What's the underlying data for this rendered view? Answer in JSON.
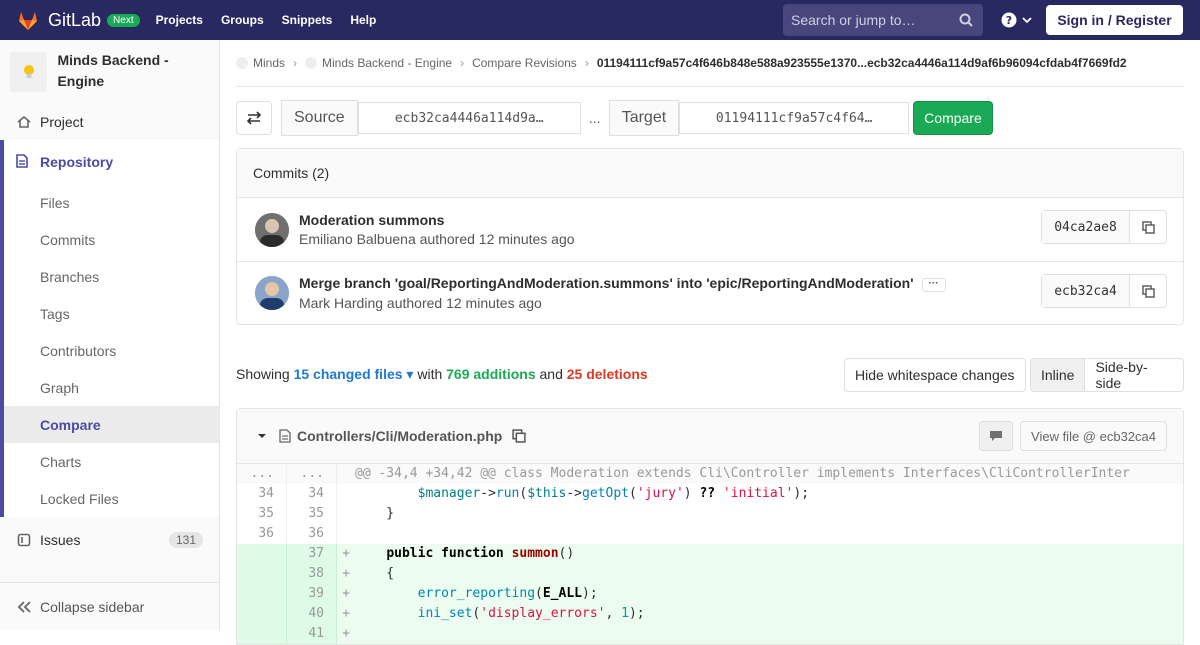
{
  "topbar": {
    "brand": "GitLab",
    "badge": "Next",
    "nav": [
      "Projects",
      "Groups",
      "Snippets",
      "Help"
    ],
    "search_placeholder": "Search or jump to…",
    "signin": "Sign in / Register"
  },
  "sidebar": {
    "project_name": "Minds Backend - Engine",
    "project": "Project",
    "repository": "Repository",
    "repo_items": [
      "Files",
      "Commits",
      "Branches",
      "Tags",
      "Contributors",
      "Graph",
      "Compare",
      "Charts",
      "Locked Files"
    ],
    "issues": "Issues",
    "issues_count": "131",
    "collapse": "Collapse sidebar"
  },
  "breadcrumb": {
    "items": [
      "Minds",
      "Minds Backend - Engine",
      "Compare Revisions"
    ],
    "current": "01194111cf9a57c4f646b848e588a923555e1370...ecb32ca4446a114d9af6b96094cfdab4f7669fd2"
  },
  "compare": {
    "source_label": "Source",
    "source_value": "ecb32ca4446a114d9a…",
    "separator": "...",
    "target_label": "Target",
    "target_value": "01194111cf9a57c4f64…",
    "button": "Compare"
  },
  "commits": {
    "header": "Commits (2)",
    "list": [
      {
        "title": "Moderation summons",
        "author": "Emiliano Balbuena",
        "meta": "authored 12 minutes ago",
        "sha": "04ca2ae8"
      },
      {
        "title": "Merge branch 'goal/ReportingAndModeration.summons' into 'epic/ReportingAndModeration'",
        "author": "Mark Harding",
        "meta": "authored 12 minutes ago",
        "sha": "ecb32ca4"
      }
    ]
  },
  "stats": {
    "showing": "Showing",
    "files": "15 changed files",
    "with": "with",
    "additions": "769 additions",
    "and": "and",
    "deletions": "25 deletions"
  },
  "view": {
    "whitespace": "Hide whitespace changes",
    "inline": "Inline",
    "side": "Side-by-side"
  },
  "diff": {
    "file": "Controllers/Cli/Moderation.php",
    "view_file": "View file @ ecb32ca4",
    "hunk": "@@ -34,4 +34,42 @@ class Moderation extends Cli\\Controller implements Interfaces\\CliControllerInter",
    "lines": [
      {
        "old": "34",
        "new": "34"
      },
      {
        "old": "35",
        "new": "35"
      },
      {
        "old": "36",
        "new": "36"
      },
      {
        "old": "",
        "new": "37"
      },
      {
        "old": "",
        "new": "38"
      },
      {
        "old": "",
        "new": "39"
      },
      {
        "old": "",
        "new": "40"
      },
      {
        "old": "",
        "new": "41"
      }
    ]
  }
}
